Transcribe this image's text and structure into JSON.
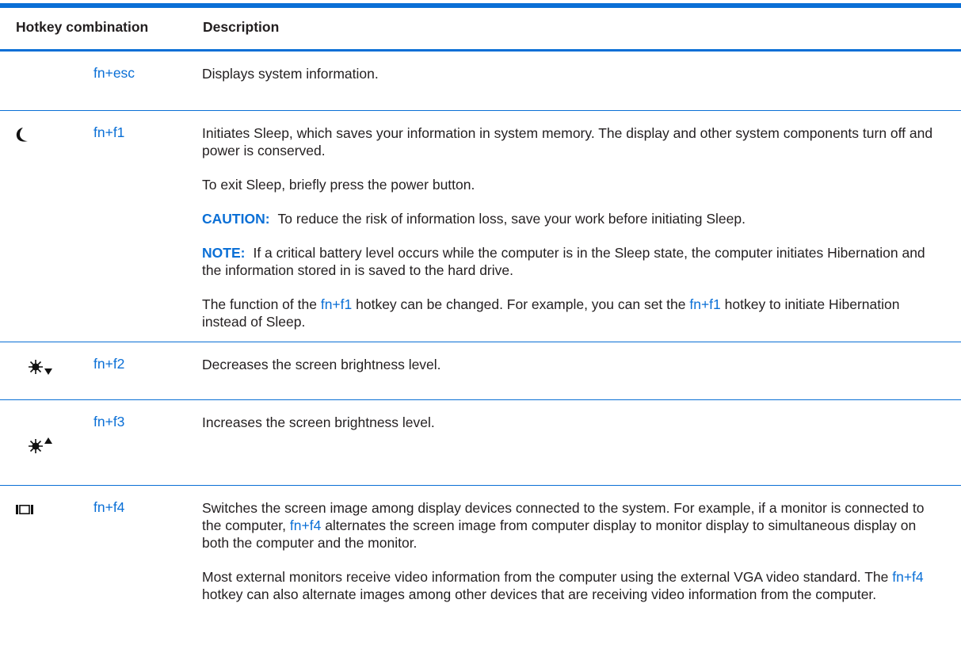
{
  "table": {
    "headers": {
      "combo": "Hotkey combination",
      "description": "Description"
    },
    "rows": [
      {
        "icon": "",
        "key": "fn+esc",
        "description": [
          "Displays system information."
        ]
      },
      {
        "icon": "sleep-moon-icon",
        "key": "fn+f1",
        "p1": "Initiates Sleep, which saves your information in system memory. The display and other system components turn off and power is conserved.",
        "p2": "To exit Sleep, briefly press the power button.",
        "caution_label": "CAUTION:",
        "caution_text": "To reduce the risk of information loss, save your work before initiating Sleep.",
        "note_label": "NOTE:",
        "note_text": "If a critical battery level occurs while the computer is in the Sleep state, the computer initiates Hibernation and the information stored in is saved to the hard drive.",
        "p5_a": "The function of the ",
        "p5_key1": "fn+f1",
        "p5_b": " hotkey can be changed. For example, you can set the ",
        "p5_key2": "fn+f1",
        "p5_c": " hotkey to initiate Hibernation instead of Sleep."
      },
      {
        "icon": "brightness-down-icon",
        "key": "fn+f2",
        "description": [
          "Decreases the screen brightness level."
        ]
      },
      {
        "icon": "brightness-up-icon",
        "key": "fn+f3",
        "description": [
          "Increases the screen brightness level."
        ]
      },
      {
        "icon": "display-switch-icon",
        "key": "fn+f4",
        "p1_a": "Switches the screen image among display devices connected to the system. For example, if a monitor is connected to the computer, ",
        "p1_key": "fn+f4",
        "p1_b": " alternates the screen image from computer display to monitor display to simultaneous display on both the computer and the monitor.",
        "p2_a": "Most external monitors receive video information from the computer using the external VGA video standard. The ",
        "p2_key": "fn+f4",
        "p2_b": " hotkey can also alternate images among other devices that are receiving video information from the computer."
      }
    ]
  },
  "colors": {
    "accent": "#0a6fd6",
    "text": "#231f20"
  }
}
